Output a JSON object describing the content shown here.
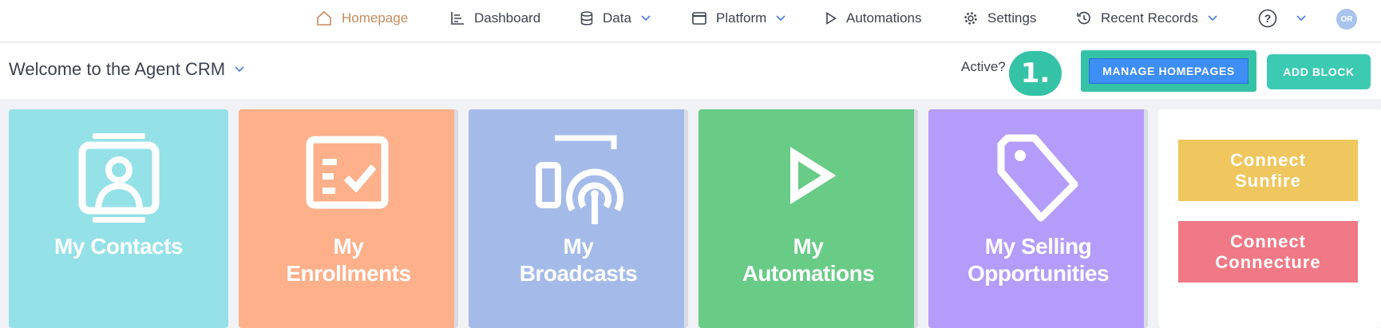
{
  "nav": {
    "homepage": "Homepage",
    "dashboard": "Dashboard",
    "data": "Data",
    "platform": "Platform",
    "automations": "Automations",
    "settings": "Settings",
    "recent_records": "Recent Records",
    "avatar_initials": "OR"
  },
  "header": {
    "title": "Welcome to the Agent CRM",
    "active_label": "Active?",
    "step_badge": "1.",
    "manage_homepages": "MANAGE HOMEPAGES",
    "add_block": "ADD BLOCK"
  },
  "tiles": [
    {
      "line1": "My Contacts",
      "line2": "",
      "color": "#95e1e8"
    },
    {
      "line1": "My",
      "line2": "Enrollments",
      "color": "#fdb08a"
    },
    {
      "line1": "My",
      "line2": "Broadcasts",
      "color": "#a4bbea"
    },
    {
      "line1": "My",
      "line2": "Automations",
      "color": "#68cb86"
    },
    {
      "line1": "My Selling",
      "line2": "Opportunities",
      "color": "#b49cfa"
    }
  ],
  "connect": {
    "sunfire_1": "Connect",
    "sunfire_2": "Sunfire",
    "sunfire_color": "#efc75e",
    "connecture_1": "Connect",
    "connecture_2": "Connecture",
    "connecture_color": "#f07985"
  }
}
